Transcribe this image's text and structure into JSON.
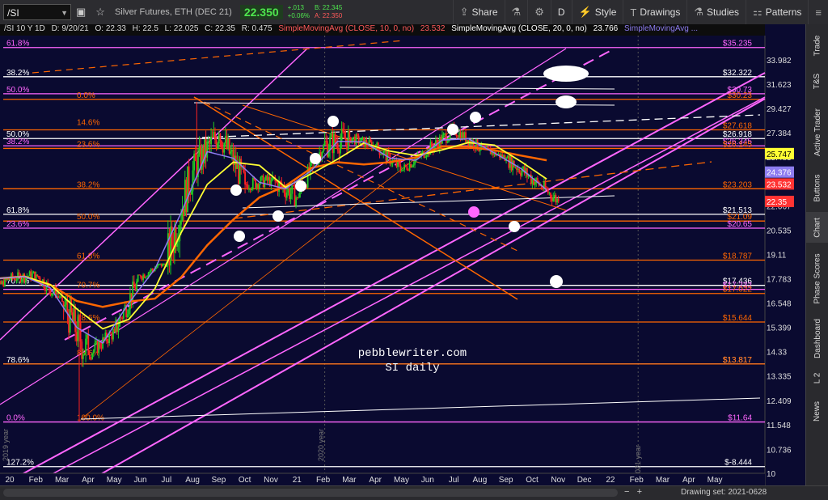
{
  "toolbar": {
    "symbol": "/SI",
    "description": "Silver Futures, ETH (DEC 21)",
    "last_price": "22.350",
    "net_change": "+.013",
    "percent_change": "+0.06%",
    "bid": "B: 22.345",
    "ask": "A: 22.350",
    "share_label": "Share",
    "aggregation": "D",
    "style_label": "Style",
    "drawings_label": "Drawings",
    "studies_label": "Studies",
    "patterns_label": "Patterns"
  },
  "info_bar": {
    "header": "/SI 10 Y 1D",
    "date": "D: 9/20/21",
    "open": "O: 22.33",
    "high": "H: 22.5",
    "low": "L: 22.025",
    "close": "C: 22.35",
    "range": "R: 0.475",
    "sma10_label": "SimpleMovingAvg (CLOSE, 10, 0, no)",
    "sma10_value": "23.532",
    "sma20_label": "SimpleMovingAvg (CLOSE, 20, 0, no)",
    "sma20_value": "23.766",
    "sma_extra_label": "SimpleMovingAvg ..."
  },
  "right_sidebar": {
    "tabs": [
      "Trade",
      "T&S",
      "Active Trader",
      "Buttons",
      "Chart",
      "Phase Scores",
      "Dashboard",
      "L 2",
      "News"
    ]
  },
  "bottom_bar": {
    "zoom_minus": "−",
    "zoom_plus": "+",
    "drawing_set": "Drawing set: 2021-0628"
  },
  "colors": {
    "background": "#0a0a30",
    "magenta": "#ff66ff",
    "orange": "#ff6600",
    "yellow": "#ffff33",
    "white": "#ffffff",
    "up_candle": "#22cc22",
    "down_candle": "#ff2222",
    "sma_purple": "#8d7cf0"
  },
  "chart_data": {
    "type": "candlestick",
    "ylabel_scale": "price",
    "ylim": [
      10,
      36.5
    ],
    "x_ticks": [
      "20",
      "Feb",
      "Mar",
      "Apr",
      "May",
      "Jun",
      "Jul",
      "Aug",
      "Sep",
      "Oct",
      "Nov",
      "21",
      "Feb",
      "Mar",
      "Apr",
      "May",
      "Jun",
      "Jul",
      "Aug",
      "Sep",
      "Oct",
      "Nov",
      "Dec",
      "22",
      "Feb",
      "Mar",
      "Apr",
      "May"
    ],
    "y_ticks": [
      33.982,
      31.623,
      29.427,
      27.384,
      25.483,
      22.067,
      20.535,
      19.11,
      17.783,
      16.548,
      15.399,
      14.33,
      13.335,
      12.409,
      11.548,
      10.736,
      10
    ],
    "year_labels": [
      "2019 year",
      "2020 year",
      "2021 year"
    ],
    "price_tags": [
      {
        "label": "25.747",
        "value": 25.747,
        "color": "#ffff33"
      },
      {
        "label": "24.376",
        "value": 24.376,
        "color": "#8d7cf0"
      },
      {
        "label": "23.532",
        "value": 23.532,
        "color": "#ff3333"
      },
      {
        "label": "22.35",
        "value": 22.35,
        "color": "#ff3333"
      }
    ],
    "level_labels": [
      {
        "text": "$35.235",
        "value": 35.235,
        "color": "#ff66ff"
      },
      {
        "text": "$32.322",
        "value": 32.322,
        "color": "#ffffff"
      },
      {
        "text": "$30.73",
        "value": 30.73,
        "color": "#ff66ff"
      },
      {
        "text": "$30.23",
        "value": 30.23,
        "color": "#ff6600"
      },
      {
        "text": "$27.618",
        "value": 27.618,
        "color": "#ff6600"
      },
      {
        "text": "$26.918",
        "value": 26.918,
        "color": "#ffffff"
      },
      {
        "text": "$26.345",
        "value": 26.345,
        "color": "#ff66ff"
      },
      {
        "text": "$26.145",
        "value": 26.145,
        "color": "#ff6600"
      },
      {
        "text": "$23.203",
        "value": 23.203,
        "color": "#ff6600"
      },
      {
        "text": "$21.513",
        "value": 21.513,
        "color": "#ffffff"
      },
      {
        "text": "$21.09",
        "value": 21.09,
        "color": "#ff6600"
      },
      {
        "text": "$20.65",
        "value": 20.65,
        "color": "#ff66ff"
      },
      {
        "text": "$18.787",
        "value": 18.787,
        "color": "#ff6600"
      },
      {
        "text": "$17.436",
        "value": 17.436,
        "color": "#ffffff"
      },
      {
        "text": "$17.232",
        "value": 17.232,
        "color": "#ff66ff"
      },
      {
        "text": "$17.022",
        "value": 17.022,
        "color": "#ff6600"
      },
      {
        "text": "$15.644",
        "value": 15.644,
        "color": "#ff6600"
      },
      {
        "text": "$13.817",
        "value": 13.817,
        "color": "#ffffff"
      },
      {
        "text": "$13.817",
        "value": 13.817,
        "color": "#ff6600"
      },
      {
        "text": "$11.64",
        "value": 11.64,
        "color": "#ff66ff"
      },
      {
        "text": "$-8.444",
        "value": 10.2,
        "color": "#ffffff"
      }
    ],
    "fib_labels": [
      {
        "text": "61.8%",
        "value": 35.235,
        "color": "#ff66ff",
        "side": "left"
      },
      {
        "text": "38.2%",
        "value": 32.322,
        "color": "#ffffff",
        "side": "left"
      },
      {
        "text": "50.0%",
        "value": 30.73,
        "color": "#ff66ff",
        "side": "left"
      },
      {
        "text": "0.0%",
        "value": 30.23,
        "color": "#ff6600",
        "side": "inner"
      },
      {
        "text": "14.6%",
        "value": 27.9,
        "color": "#ff6600",
        "side": "inner"
      },
      {
        "text": "50.0%",
        "value": 26.918,
        "color": "#ffffff",
        "side": "left"
      },
      {
        "text": "38.2%",
        "value": 26.345,
        "color": "#ff66ff",
        "side": "left"
      },
      {
        "text": "23.6%",
        "value": 26.145,
        "color": "#ff6600",
        "side": "inner"
      },
      {
        "text": "38.2%",
        "value": 23.203,
        "color": "#ff6600",
        "side": "inner"
      },
      {
        "text": "61.8%",
        "value": 21.513,
        "color": "#ffffff",
        "side": "left"
      },
      {
        "text": "50.0%",
        "value": 21.09,
        "color": "#ff6600",
        "side": "inner"
      },
      {
        "text": "23.6%",
        "value": 20.65,
        "color": "#ff66ff",
        "side": "left"
      },
      {
        "text": "61.8%",
        "value": 18.787,
        "color": "#ff6600",
        "side": "inner"
      },
      {
        "text": "70.7%",
        "value": 17.436,
        "color": "#ffffff",
        "side": "left"
      },
      {
        "text": "70.7%",
        "value": 17.232,
        "color": "#ff6600",
        "side": "inner"
      },
      {
        "text": "78.6%",
        "value": 15.644,
        "color": "#ff6600",
        "side": "inner"
      },
      {
        "text": "78.6%",
        "value": 13.817,
        "color": "#ffffff",
        "side": "left"
      },
      {
        "text": "88.6%",
        "value": 14.1,
        "color": "#ff6600",
        "side": "inner"
      },
      {
        "text": "0.0%",
        "value": 11.64,
        "color": "#ff66ff",
        "side": "left"
      },
      {
        "text": "100.0%",
        "value": 11.64,
        "color": "#ff6600",
        "side": "inner"
      },
      {
        "text": "127.2%",
        "value": 10.2,
        "color": "#ffffff",
        "side": "left"
      }
    ],
    "annotation": [
      "pebblewriter.com",
      "SI daily"
    ],
    "candles_monthly_approx": [
      {
        "m": "Dec19",
        "o": 16.9,
        "h": 17.9,
        "l": 16.6,
        "c": 17.8
      },
      {
        "m": "Jan20",
        "o": 17.8,
        "h": 18.8,
        "l": 17.2,
        "c": 18.0
      },
      {
        "m": "Feb20",
        "o": 18.0,
        "h": 18.9,
        "l": 16.8,
        "c": 16.6
      },
      {
        "m": "Mar20",
        "o": 16.6,
        "h": 17.0,
        "l": 11.64,
        "c": 14.2
      },
      {
        "m": "Apr20",
        "o": 14.2,
        "h": 15.9,
        "l": 14.0,
        "c": 15.2
      },
      {
        "m": "May20",
        "o": 15.2,
        "h": 18.0,
        "l": 14.9,
        "c": 17.9
      },
      {
        "m": "Jun20",
        "o": 17.9,
        "h": 18.6,
        "l": 17.2,
        "c": 18.7
      },
      {
        "m": "Jul20",
        "o": 18.7,
        "h": 26.3,
        "l": 18.0,
        "c": 24.5
      },
      {
        "m": "Aug20",
        "o": 24.5,
        "h": 30.0,
        "l": 23.0,
        "c": 27.3
      },
      {
        "m": "Sep20",
        "o": 27.3,
        "h": 28.0,
        "l": 21.6,
        "c": 23.5
      },
      {
        "m": "Oct20",
        "o": 23.5,
        "h": 25.5,
        "l": 22.9,
        "c": 23.8
      },
      {
        "m": "Nov20",
        "o": 23.8,
        "h": 25.8,
        "l": 21.9,
        "c": 22.6
      },
      {
        "m": "Dec20",
        "o": 22.6,
        "h": 26.5,
        "l": 22.6,
        "c": 26.4
      },
      {
        "m": "Jan21",
        "o": 26.4,
        "h": 30.1,
        "l": 24.2,
        "c": 27.0
      },
      {
        "m": "Feb21",
        "o": 27.0,
        "h": 28.4,
        "l": 25.9,
        "c": 26.3
      },
      {
        "m": "Mar21",
        "o": 26.3,
        "h": 26.7,
        "l": 24.0,
        "c": 24.5
      },
      {
        "m": "Apr21",
        "o": 24.5,
        "h": 26.3,
        "l": 24.0,
        "c": 26.0
      },
      {
        "m": "May21",
        "o": 26.0,
        "h": 28.7,
        "l": 25.5,
        "c": 27.6
      },
      {
        "m": "Jun21",
        "o": 27.6,
        "h": 28.3,
        "l": 25.6,
        "c": 26.2
      },
      {
        "m": "Jul21",
        "o": 26.2,
        "h": 26.9,
        "l": 25.0,
        "c": 25.4
      },
      {
        "m": "Aug21",
        "o": 25.4,
        "h": 25.6,
        "l": 22.2,
        "c": 23.9
      },
      {
        "m": "Sep21",
        "o": 23.9,
        "h": 24.8,
        "l": 22.0,
        "c": 22.35
      }
    ]
  }
}
